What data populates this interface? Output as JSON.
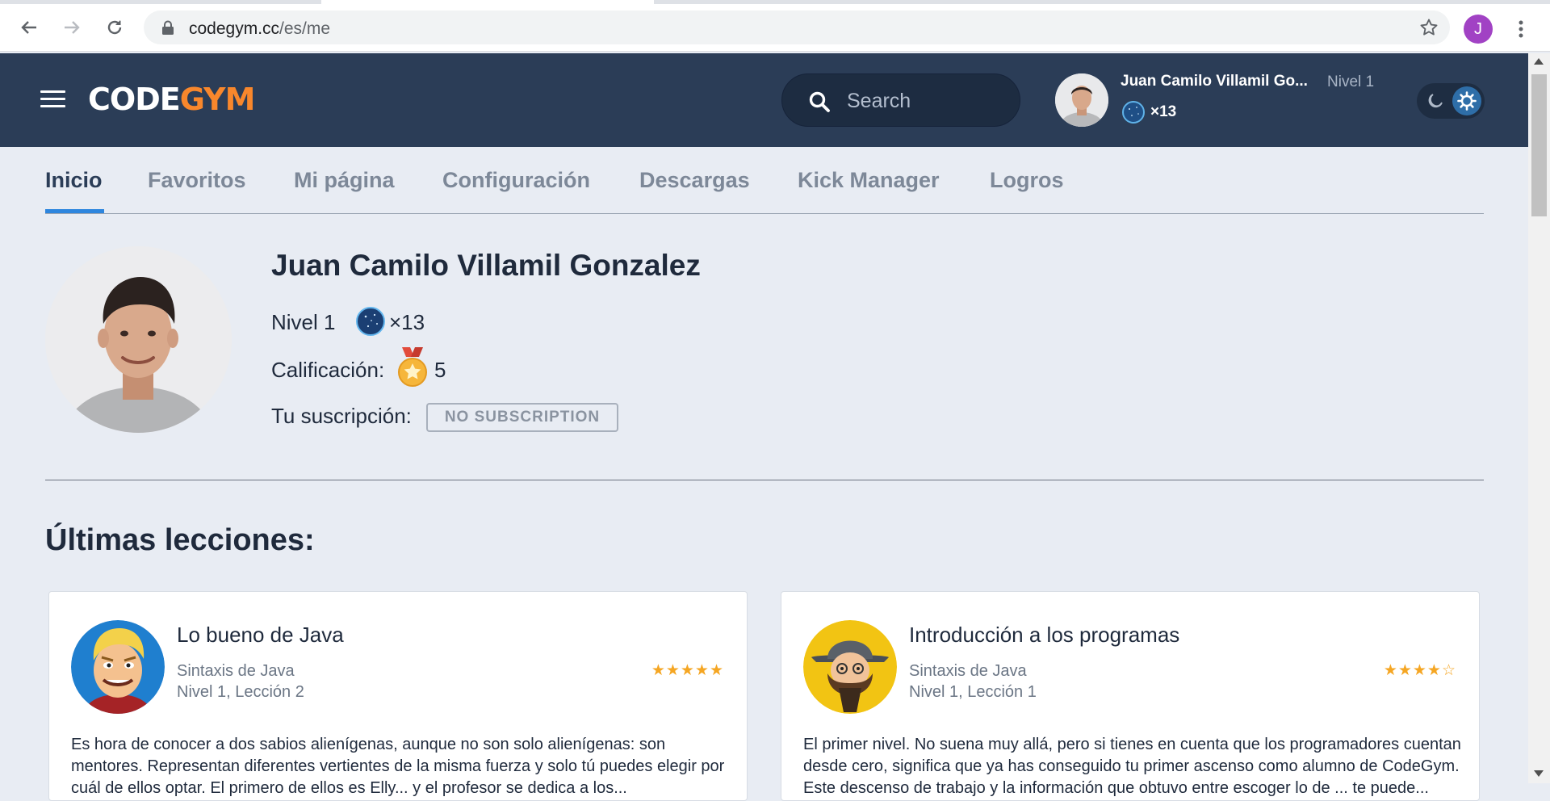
{
  "browser": {
    "url_host": "codegym.cc",
    "url_path": "/es/me",
    "profile_initial": "J"
  },
  "header": {
    "logo_code": "CODE",
    "logo_gym": "GYM",
    "search_placeholder": "Search",
    "user_name": "Juan Camilo Villamil Go...",
    "level": "Nivel 1",
    "orbs": "×13"
  },
  "nav": {
    "tabs": [
      {
        "label": "Inicio",
        "active": true
      },
      {
        "label": "Favoritos"
      },
      {
        "label": "Mi página"
      },
      {
        "label": "Configuración"
      },
      {
        "label": "Descargas"
      },
      {
        "label": "Kick Manager"
      },
      {
        "label": "Logros"
      }
    ]
  },
  "profile": {
    "name": "Juan Camilo Villamil Gonzalez",
    "level": "Nivel 1",
    "orbs": "×13",
    "rating_label": "Calificación:",
    "rating_value": "5",
    "subscription_label": "Tu suscripción:",
    "subscription_value": "NO SUBSCRIPTION"
  },
  "lessons": {
    "title": "Últimas lecciones:",
    "items": [
      {
        "title": "Lo bueno de Java",
        "quest": "Sintaxis de Java",
        "level": "Nivel 1, Lección 2",
        "rating": 5,
        "stars_text": "★★★★★",
        "description": "Es hora de conocer a dos sabios alienígenas, aunque no son solo alienígenas: son mentores. Representan diferentes vertientes de la misma fuerza y solo tú puedes elegir por cuál de ellos optar. El primero de ellos es Elly... y el profesor se dedica a los..."
      },
      {
        "title": "Introducción a los programas",
        "quest": "Sintaxis de Java",
        "level": "Nivel 1, Lección 1",
        "rating": 4,
        "stars_text": "★★★★☆",
        "description": "El primer nivel. No suena muy allá, pero si tienes en cuenta que los programadores cuentan desde cero, significa que ya has conseguido tu primer ascenso como alumno de CodeGym. Este descenso de trabajo y la información que obtuvo entre escoger lo de ... te puede..."
      }
    ]
  },
  "colors": {
    "header_bg": "#2b3d57",
    "accent_orange": "#f8872c",
    "tab_active_underline": "#2e86de",
    "star": "#f5a623",
    "page_bg": "#e8ecf3"
  }
}
